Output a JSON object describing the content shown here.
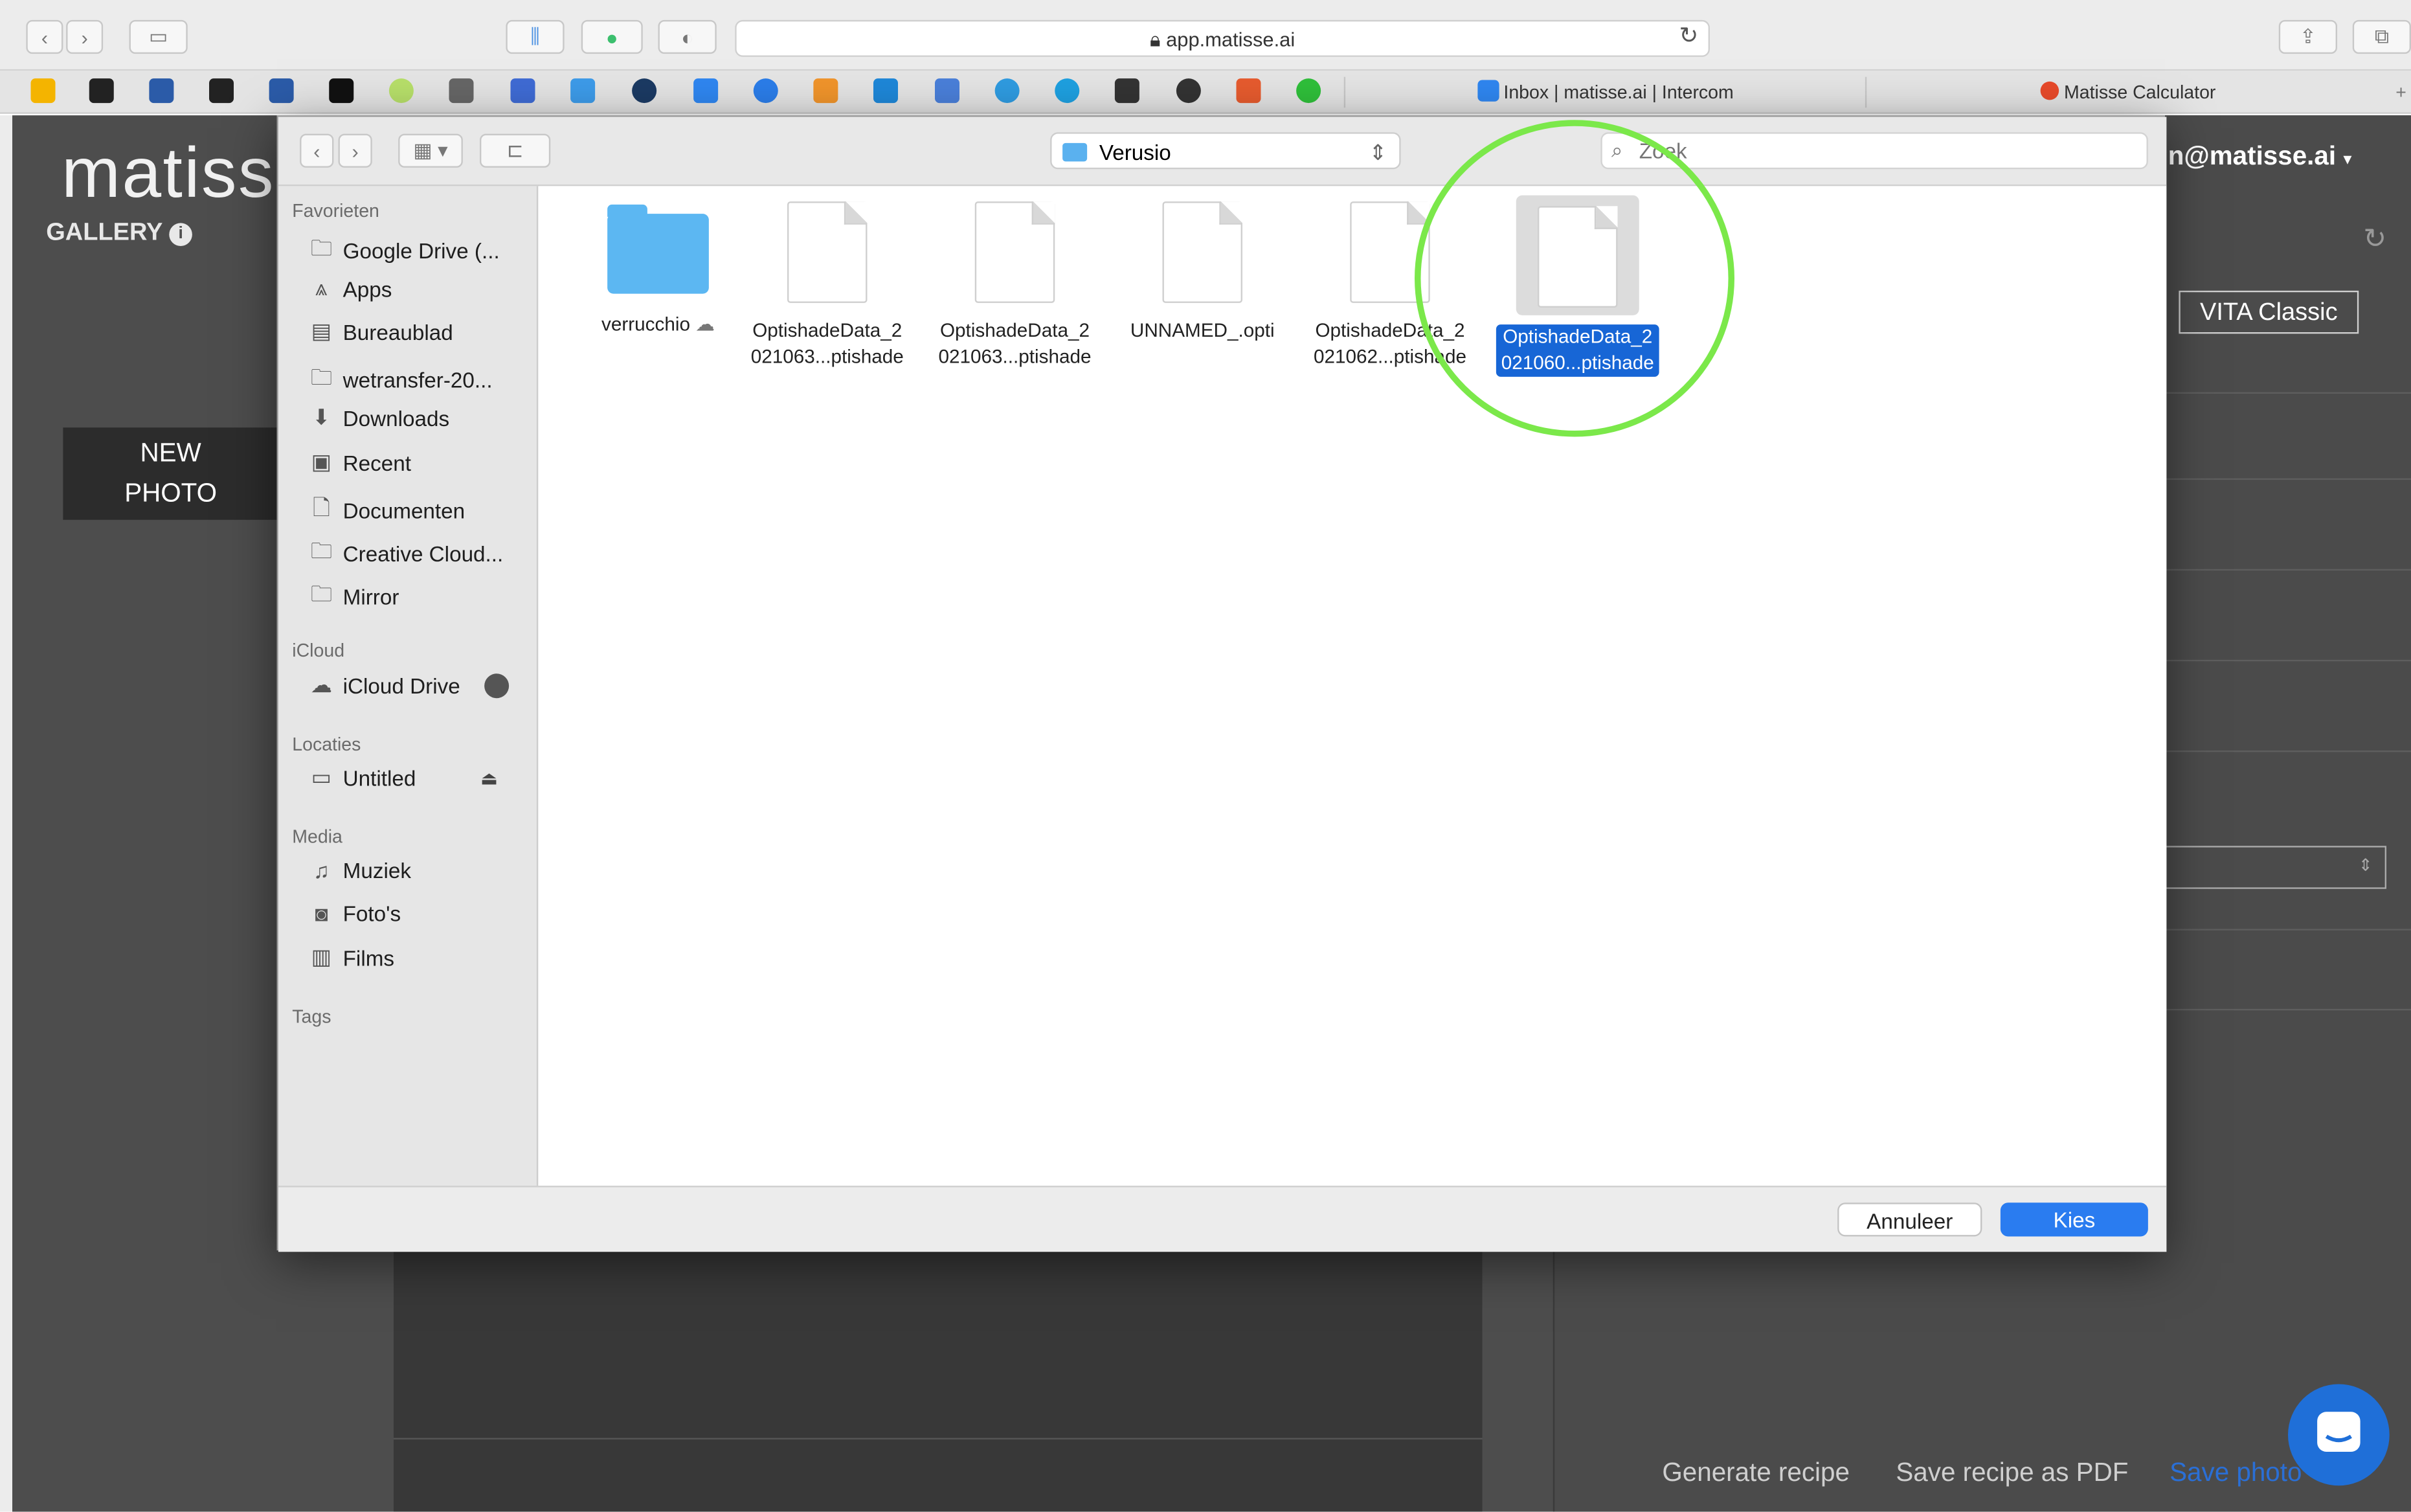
{
  "browser": {
    "url": "app.matisse.ai",
    "tabs": [
      "Inbox | matisse.ai | Intercom",
      "Matisse Calculator"
    ],
    "new_tab": "+"
  },
  "page": {
    "logo": "matiss",
    "gallery": "GALLERY",
    "new_photo": [
      "NEW",
      "PHOTO"
    ],
    "email": "n@matisse.ai",
    "shade_guide": "VITA Classic",
    "footer": [
      "Generate recipe",
      "Save recipe as PDF",
      "Save photo"
    ]
  },
  "dialog": {
    "location": "Verusio",
    "search_placeholder": "Zoek",
    "sidebar": {
      "favorites_title": "Favorieten",
      "favorites": [
        "Google Drive (...",
        "Apps",
        "Bureaublad",
        "wetransfer-20...",
        "Downloads",
        "Recent",
        "Documenten",
        "Creative Cloud...",
        "Mirror"
      ],
      "icloud_title": "iCloud",
      "icloud": [
        "iCloud Drive"
      ],
      "locations_title": "Locaties",
      "locations": [
        "Untitled"
      ],
      "media_title": "Media",
      "media": [
        "Muziek",
        "Foto's",
        "Films"
      ],
      "tags_title": "Tags"
    },
    "files": [
      {
        "line1": "verrucchio",
        "line2": "",
        "kind": "folder"
      },
      {
        "line1": "OptishadeData_2",
        "line2": "021063...ptishade",
        "kind": "file"
      },
      {
        "line1": "OptishadeData_2",
        "line2": "021063...ptishade",
        "kind": "file"
      },
      {
        "line1": "UNNAMED_.opti",
        "line2": "",
        "kind": "file"
      },
      {
        "line1": "OptishadeData_2",
        "line2": "021062...ptishade",
        "kind": "file"
      },
      {
        "line1": "OptishadeData_2",
        "line2": "021060...ptishade",
        "kind": "file",
        "selected": true
      }
    ],
    "cancel": "Annuleer",
    "choose": "Kies"
  },
  "colors": {
    "highlight_ring": "#7be84a",
    "accent": "#1766d6",
    "page_bg": "#4d4d4d"
  }
}
